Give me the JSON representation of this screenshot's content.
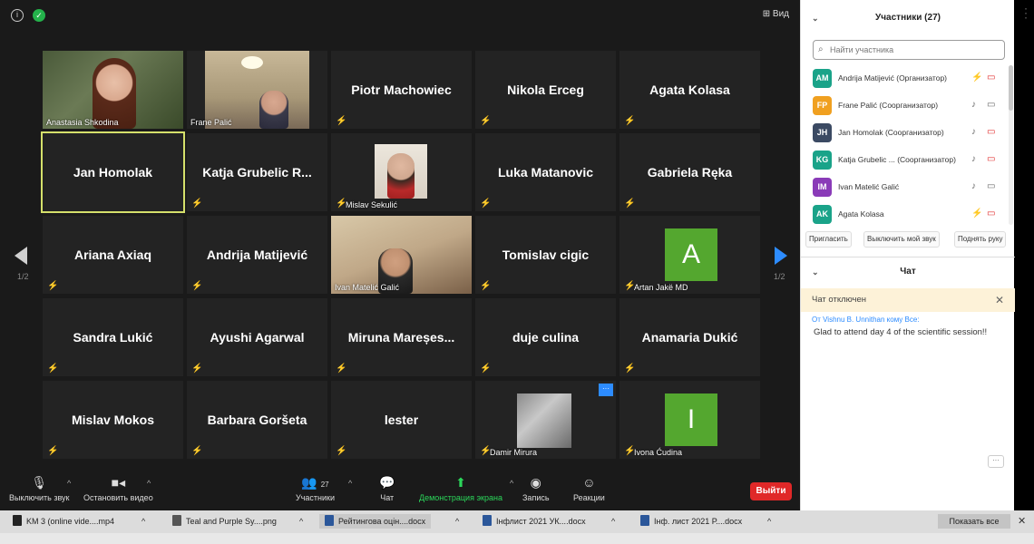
{
  "top": {
    "view_label": "Вид"
  },
  "tiles": [
    {
      "id": "t1",
      "name": "Anastasia Shkodina",
      "video": true
    },
    {
      "id": "t2",
      "name": "Frane Palić",
      "video": true
    },
    {
      "id": "t3",
      "name": "Piotr Machowiec"
    },
    {
      "id": "t4",
      "name": "Nikola Erceg"
    },
    {
      "id": "t5",
      "name": "Agata Kolasa"
    },
    {
      "id": "t6",
      "name": "Jan Homolak"
    },
    {
      "id": "t7",
      "name": "Katja  Grubelic  R..."
    },
    {
      "id": "t8",
      "name": "Mislav Sekulić",
      "video": true
    },
    {
      "id": "t9",
      "name": "Luka Matanovic"
    },
    {
      "id": "t10",
      "name": "Gabriela Ręka"
    },
    {
      "id": "t11",
      "name": "Ariana Axiaq"
    },
    {
      "id": "t12",
      "name": "Andrija Matijević"
    },
    {
      "id": "t13",
      "name": "Ivan Matelić Galić",
      "video": true
    },
    {
      "id": "t14",
      "name": "Tomislav cigic"
    },
    {
      "id": "t15",
      "name": "Artan Jakë MD",
      "avatar": "A"
    },
    {
      "id": "t16",
      "name": "Sandra Lukić"
    },
    {
      "id": "t17",
      "name": "Ayushi Agarwal"
    },
    {
      "id": "t18",
      "name": "Miruna  Mareșes..."
    },
    {
      "id": "t19",
      "name": "duje culina"
    },
    {
      "id": "t20",
      "name": "Anamaria Dukić"
    },
    {
      "id": "t21",
      "name": "Mislav Mokos"
    },
    {
      "id": "t22",
      "name": "Barbara Goršeta"
    },
    {
      "id": "t23",
      "name": "lester"
    },
    {
      "id": "t24",
      "name": "Damir Mirura",
      "video": true
    },
    {
      "id": "t25",
      "name": "Ivona Ćudina",
      "avatar": "I"
    }
  ],
  "pager": {
    "left": "1/2",
    "right": "1/2"
  },
  "toolbar": {
    "mute": "Выключить звук",
    "video": "Остановить видео",
    "participants": "Участники",
    "participants_count": "27",
    "chat": "Чат",
    "share": "Демонстрация экрана",
    "record": "Запись",
    "reactions": "Реакции",
    "leave": "Выйти"
  },
  "panel": {
    "participants_title": "Участники (27)",
    "search_placeholder": "Найти участника",
    "participants": [
      {
        "initials": "AM",
        "name": "Andrija Matijević (Организатор)",
        "color": "#1aa389"
      },
      {
        "initials": "FP",
        "name": "Frane Palić (Соорганизатор)",
        "color": "#f0a020"
      },
      {
        "initials": "JH",
        "name": "Jan Homolak (Соорганизатор)",
        "color": "#3b4a63"
      },
      {
        "initials": "KG",
        "name": "Katja Grubelic ... (Соорганизатор)",
        "color": "#1aa389"
      },
      {
        "initials": "IM",
        "name": "Ivan Matelić Galić",
        "color": "#8a3bb8"
      },
      {
        "initials": "AK",
        "name": "Agata Kolasa",
        "color": "#1aa389"
      }
    ],
    "invite": "Пригласить",
    "unmute_me": "Выключить мой звук",
    "raise_hand": "Поднять руку",
    "chat_title": "Чат",
    "chat_disabled": "Чат отключен",
    "chat_from": "От Vishnu B. Unnithan кому Все:",
    "chat_message": "Glad to attend day 4 of the scientific session!!"
  },
  "taskbar": {
    "items": [
      "KM 3 (online vide....mp4",
      "Teal and Purple Sy....png",
      "Рейтингова оцін....docx",
      "Інфлист 2021 УК....docx",
      "Інф. лист 2021 Р....docx"
    ],
    "show_all": "Показать все"
  },
  "colors": {
    "accent": "#2d8cff",
    "leave": "#e02828",
    "share": "#2bd65a",
    "avatar_tile": "#54a72f",
    "active_border": "#d5e06b"
  }
}
